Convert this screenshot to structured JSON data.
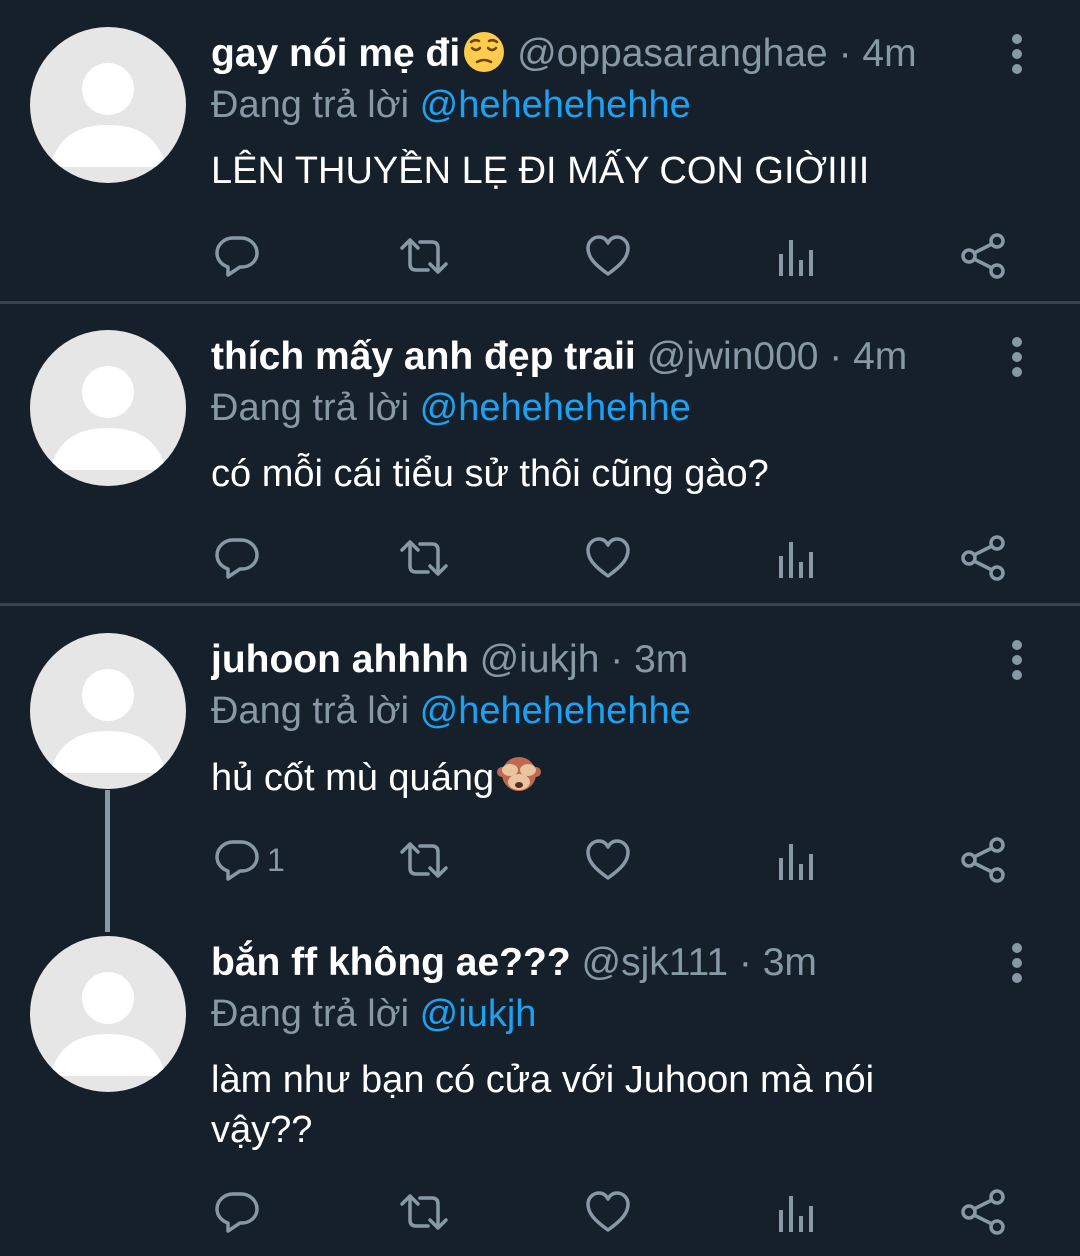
{
  "tweets": [
    {
      "name": "gay nói mẹ đi",
      "name_emoji": "pensive-face",
      "handle": "@oppasaranghae",
      "time": "· 4m",
      "replying_label": "Đang trả lời",
      "replying_to": "@hehehehehhe",
      "text": "LÊN THUYỀN LẸ ĐI MẤY CON GIỜIIII",
      "reply_count": ""
    },
    {
      "name": "thích mấy anh đẹp traii",
      "handle": "@jwin000",
      "time": "· 4m",
      "replying_label": "Đang trả lời",
      "replying_to": "@hehehehehhe",
      "text": "có mỗi cái tiểu sử thôi cũng gào?",
      "reply_count": ""
    },
    {
      "name": "juhoon ahhhh",
      "handle": "@iukjh",
      "time": "· 3m",
      "replying_label": "Đang trả lời",
      "replying_to": "@hehehehehhe",
      "text": "hủ cốt mù quáng",
      "text_emoji": "see-no-evil-monkey",
      "reply_count": "1"
    },
    {
      "name": "bắn ff không ae???",
      "handle": "@sjk111",
      "time": "· 3m",
      "replying_label": "Đang trả lời",
      "replying_to": "@iukjh",
      "text": "làm như bạn có cửa với Juhoon mà nói vậy??",
      "reply_count": ""
    }
  ],
  "icons": {
    "reply": "reply-icon",
    "retweet": "retweet-icon",
    "like": "heart-icon",
    "analytics": "analytics-icon",
    "share": "share-icon",
    "more": "more-vertical-icon"
  },
  "colors": {
    "background": "#15202b",
    "divider": "#38444d",
    "secondary_text": "#8899a6",
    "mention": "#1da1f2",
    "avatar": "#e6e6e6"
  }
}
